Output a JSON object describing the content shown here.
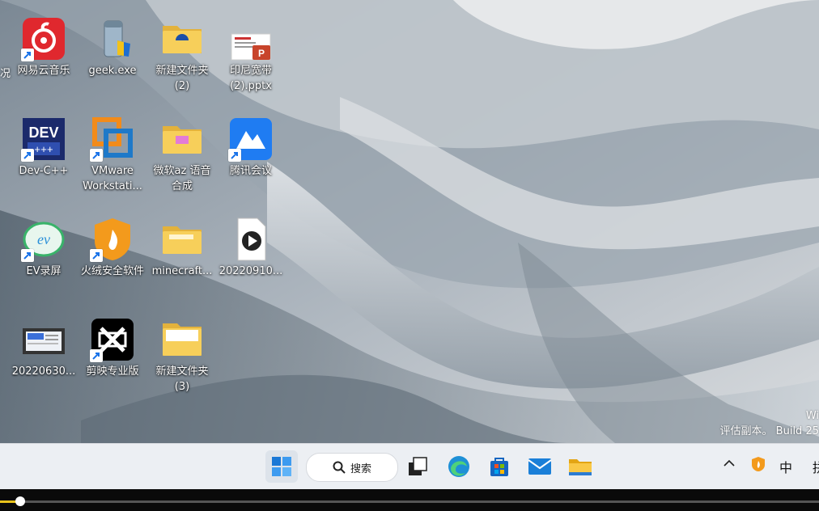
{
  "desktop": {
    "cutoff_label": "况",
    "icons": [
      {
        "label": "网易云音乐",
        "icon": "netease-music-icon"
      },
      {
        "label": "geek.exe",
        "icon": "geek-icon"
      },
      {
        "label": "新建文件夹\n(2)",
        "icon": "folder-icon"
      },
      {
        "label": "印尼宽带\n(2).pptx",
        "icon": "pptx-file-icon"
      },
      {
        "label": "Dev-C++",
        "icon": "devcpp-icon"
      },
      {
        "label": "VMware\nWorkstati...",
        "icon": "vmware-icon"
      },
      {
        "label": "微软az 语音\n合成",
        "icon": "folder-icon"
      },
      {
        "label": "腾讯会议",
        "icon": "tencent-meeting-icon"
      },
      {
        "label": "EV录屏",
        "icon": "ev-recorder-icon"
      },
      {
        "label": "火绒安全软件",
        "icon": "huorong-icon"
      },
      {
        "label": "minecraft...",
        "icon": "folder-icon"
      },
      {
        "label": "20220910...",
        "icon": "video-file-icon"
      },
      {
        "label": "20220630...",
        "icon": "video-thumbnail-icon"
      },
      {
        "label": "剪映专业版",
        "icon": "capcut-icon"
      },
      {
        "label": "新建文件夹\n(3)",
        "icon": "folder-icon"
      }
    ]
  },
  "watermark": {
    "line1": "Wi",
    "line2": "评估副本。 Build 25"
  },
  "taskbar": {
    "search_label": "搜索",
    "apps": [
      "start-icon",
      "task-view-icon",
      "edge-icon",
      "store-icon",
      "mail-icon",
      "file-explorer-icon"
    ],
    "tray_ime": "中",
    "tray_cut": "拼"
  },
  "video_player": {
    "progress": 0.025
  },
  "colors": {
    "accent": "#0067c0",
    "progress": "#e9c31c",
    "taskbar": "#eceff3"
  }
}
